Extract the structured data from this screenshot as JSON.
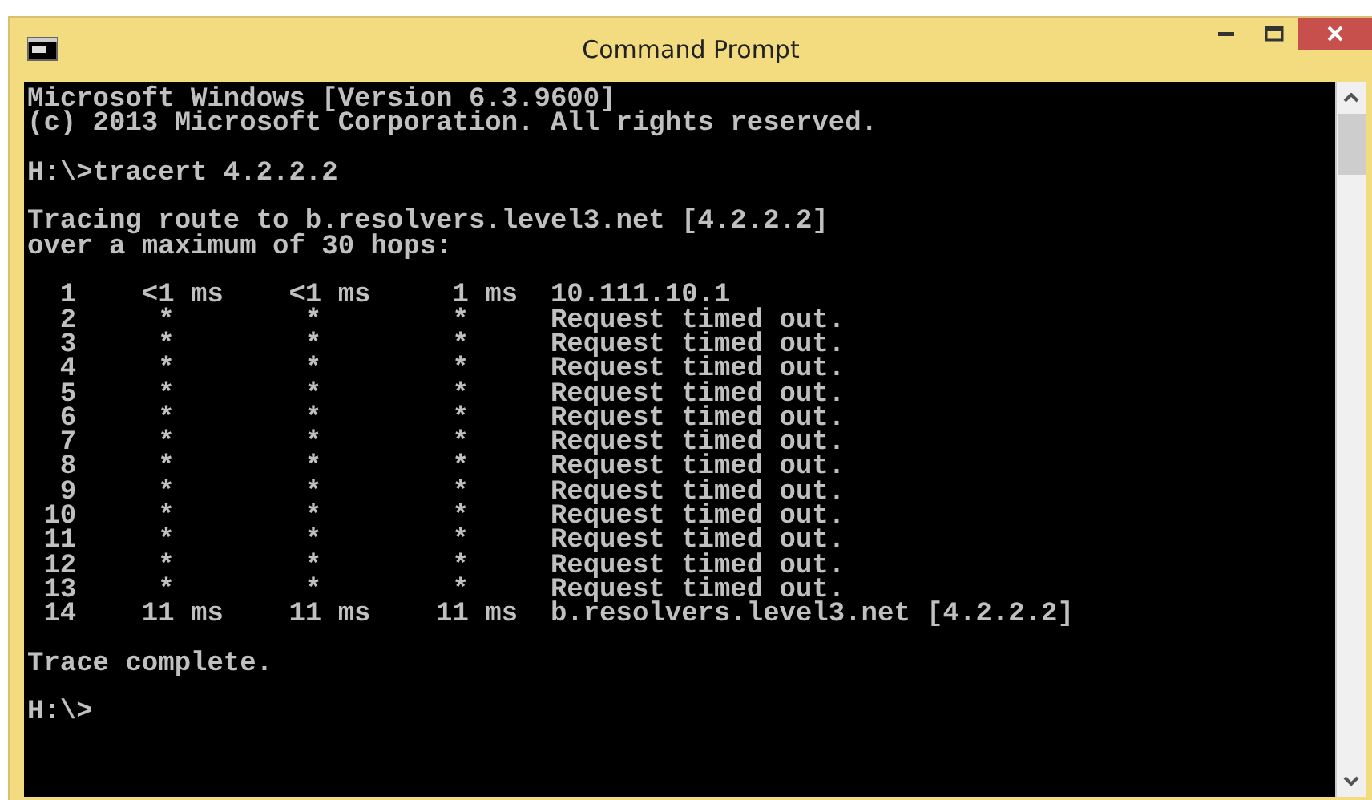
{
  "window": {
    "title": "Command Prompt"
  },
  "console": {
    "paragraphs": [
      [
        "Microsoft Windows [Version 6.3.9600]",
        "(c) 2013 Microsoft Corporation. All rights reserved."
      ],
      [
        "H:\\>tracert 4.2.2.2"
      ],
      [
        "Tracing route to b.resolvers.level3.net [4.2.2.2]",
        "over a maximum of 30 hops:"
      ],
      [
        "  1    <1 ms    <1 ms     1 ms  10.111.10.1",
        "  2     *        *        *     Request timed out.",
        "  3     *        *        *     Request timed out.",
        "  4     *        *        *     Request timed out.",
        "  5     *        *        *     Request timed out.",
        "  6     *        *        *     Request timed out.",
        "  7     *        *        *     Request timed out.",
        "  8     *        *        *     Request timed out.",
        "  9     *        *        *     Request timed out.",
        " 10     *        *        *     Request timed out.",
        " 11     *        *        *     Request timed out.",
        " 12     *        *        *     Request timed out.",
        " 13     *        *        *     Request timed out.",
        " 14    11 ms    11 ms    11 ms  b.resolvers.level3.net [4.2.2.2]"
      ],
      [
        "Trace complete."
      ],
      [
        "H:\\>"
      ]
    ]
  }
}
